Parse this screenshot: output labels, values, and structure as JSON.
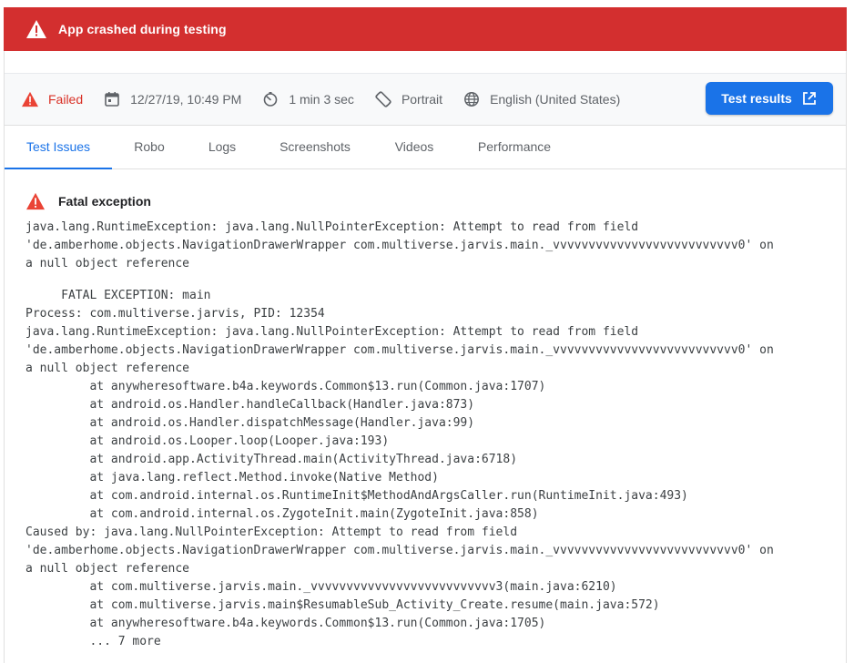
{
  "banner": {
    "title": "App crashed during testing"
  },
  "meta": {
    "status": "Failed",
    "datetime": "12/27/19, 10:49 PM",
    "duration": "1 min 3 sec",
    "orientation": "Portrait",
    "locale": "English (United States)",
    "results_button": "Test results"
  },
  "tabs": [
    {
      "label": "Test Issues",
      "active": true
    },
    {
      "label": "Robo"
    },
    {
      "label": "Logs"
    },
    {
      "label": "Screenshots"
    },
    {
      "label": "Videos"
    },
    {
      "label": "Performance"
    }
  ],
  "issue": {
    "title": "Fatal exception",
    "summary": "java.lang.RuntimeException: java.lang.NullPointerException: Attempt to read from field\n'de.amberhome.objects.NavigationDrawerWrapper com.multiverse.jarvis.main._vvvvvvvvvvvvvvvvvvvvvvvvvv0' on\na null object reference",
    "trace": "     FATAL EXCEPTION: main\nProcess: com.multiverse.jarvis, PID: 12354\njava.lang.RuntimeException: java.lang.NullPointerException: Attempt to read from field\n'de.amberhome.objects.NavigationDrawerWrapper com.multiverse.jarvis.main._vvvvvvvvvvvvvvvvvvvvvvvvvv0' on\na null object reference\n         at anywheresoftware.b4a.keywords.Common$13.run(Common.java:1707)\n         at android.os.Handler.handleCallback(Handler.java:873)\n         at android.os.Handler.dispatchMessage(Handler.java:99)\n         at android.os.Looper.loop(Looper.java:193)\n         at android.app.ActivityThread.main(ActivityThread.java:6718)\n         at java.lang.reflect.Method.invoke(Native Method)\n         at com.android.internal.os.RuntimeInit$MethodAndArgsCaller.run(RuntimeInit.java:493)\n         at com.android.internal.os.ZygoteInit.main(ZygoteInit.java:858)\nCaused by: java.lang.NullPointerException: Attempt to read from field\n'de.amberhome.objects.NavigationDrawerWrapper com.multiverse.jarvis.main._vvvvvvvvvvvvvvvvvvvvvvvvvv0' on\na null object reference\n         at com.multiverse.jarvis.main._vvvvvvvvvvvvvvvvvvvvvvvvvv3(main.java:6210)\n         at com.multiverse.jarvis.main$ResumableSub_Activity_Create.resume(main.java:572)\n         at anywheresoftware.b4a.keywords.Common$13.run(Common.java:1705)\n         ... 7 more"
  },
  "colors": {
    "banner": "#d32f2f",
    "accent": "#1a73e8",
    "error": "#d93025"
  },
  "icons": {
    "banner": "warning-icon",
    "status": "warning-icon",
    "date": "calendar-icon",
    "duration": "timer-icon",
    "orientation": "screen-rotation-icon",
    "locale": "globe-icon",
    "button": "open-in-new-icon"
  }
}
